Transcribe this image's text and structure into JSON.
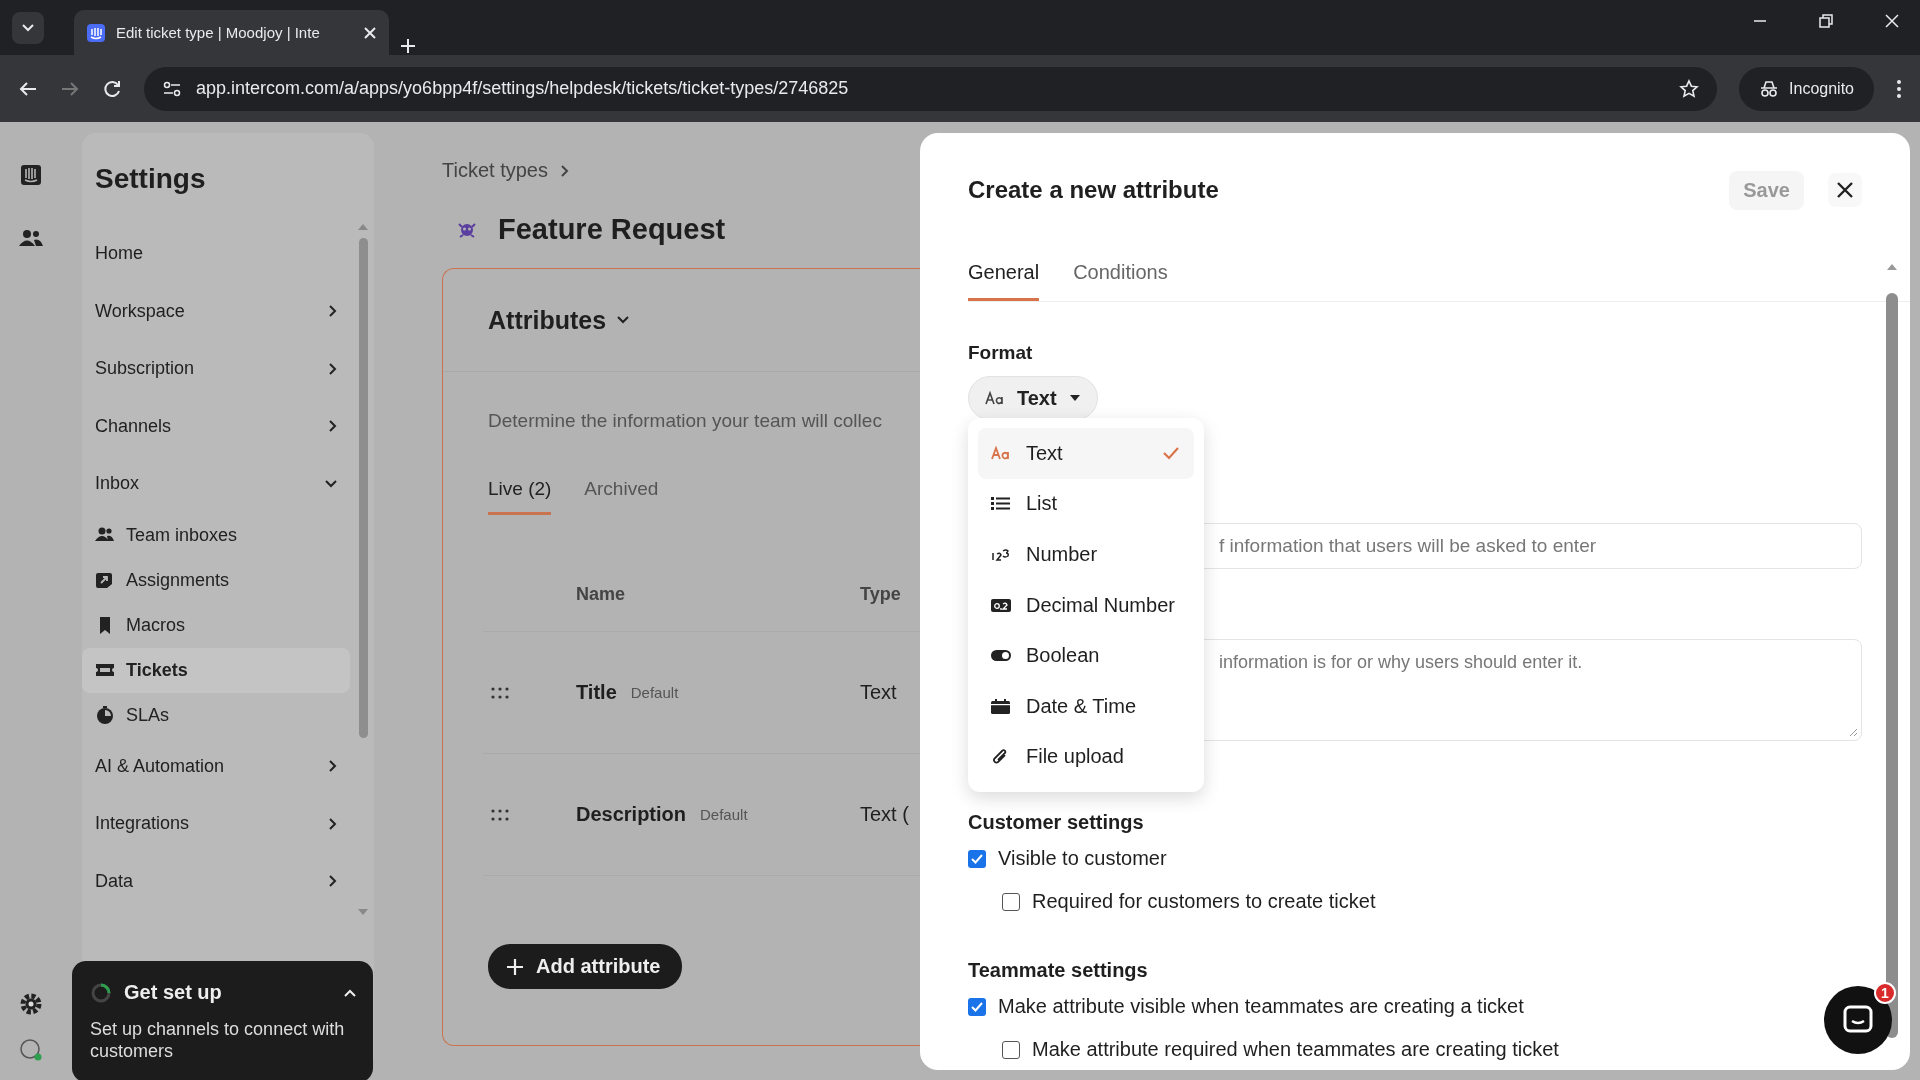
{
  "browser": {
    "tab_title": "Edit ticket type | Moodjoy | Inte",
    "url": "app.intercom.com/a/apps/yo6bpp4f/settings/helpdesk/tickets/ticket-types/2746825",
    "profile": "Incognito"
  },
  "sidebar": {
    "title": "Settings",
    "items": [
      {
        "kind": "link",
        "label": "Home"
      },
      {
        "kind": "group",
        "label": "Workspace",
        "expanded": false
      },
      {
        "kind": "group",
        "label": "Subscription",
        "expanded": false
      },
      {
        "kind": "group",
        "label": "Channels",
        "expanded": false
      },
      {
        "kind": "group",
        "label": "Inbox",
        "expanded": true,
        "children": [
          {
            "kind": "team",
            "label": "Team inboxes",
            "selected": false
          },
          {
            "kind": "assign",
            "label": "Assignments",
            "selected": false
          },
          {
            "kind": "macro",
            "label": "Macros",
            "selected": false
          },
          {
            "kind": "ticket",
            "label": "Tickets",
            "selected": true
          },
          {
            "kind": "sla",
            "label": "SLAs",
            "selected": false
          }
        ]
      },
      {
        "kind": "group",
        "label": "AI & Automation",
        "expanded": false
      },
      {
        "kind": "group",
        "label": "Integrations",
        "expanded": false
      },
      {
        "kind": "group",
        "label": "Data",
        "expanded": false
      }
    ],
    "setup_card": {
      "title": "Get set up",
      "text": "Set up channels to connect with customers"
    }
  },
  "main": {
    "breadcrumb": "Ticket types",
    "title": "Feature Request",
    "section": "Attributes",
    "description": "Determine the information your team will collec",
    "tabs": [
      {
        "label": "Live (2)",
        "selected": true
      },
      {
        "label": "Archived",
        "selected": false
      }
    ],
    "columns": [
      "Name",
      "Type"
    ],
    "rows": [
      {
        "name": "Title",
        "badge": "Default",
        "type": "Text"
      },
      {
        "name": "Description",
        "badge": "Default",
        "type": "Text ("
      }
    ],
    "add_button": "Add attribute"
  },
  "panel": {
    "title": "Create a new attribute",
    "save": "Save",
    "tabs": [
      {
        "label": "General",
        "selected": true
      },
      {
        "label": "Conditions",
        "selected": false
      }
    ],
    "format_label": "Format",
    "format_value": "Text",
    "format_options": [
      {
        "kind": "text",
        "label": "Text",
        "selected": true
      },
      {
        "kind": "list",
        "label": "List",
        "selected": false
      },
      {
        "kind": "number",
        "label": "Number",
        "selected": false
      },
      {
        "kind": "decimal",
        "label": "Decimal Number",
        "selected": false
      },
      {
        "kind": "boolean",
        "label": "Boolean",
        "selected": false
      },
      {
        "kind": "datetime",
        "label": "Date & Time",
        "selected": false
      },
      {
        "kind": "file",
        "label": "File upload",
        "selected": false
      }
    ],
    "name_placeholder": "f information that users will be asked to enter",
    "description_placeholder": "information is for or why users should enter it.",
    "sections": [
      {
        "title": "Customer settings",
        "options": [
          {
            "label": "Visible to customer",
            "checked": true,
            "children": [
              {
                "label": "Required for customers to create ticket",
                "checked": false
              }
            ]
          }
        ]
      },
      {
        "title": "Teammate settings",
        "options": [
          {
            "label": "Make attribute visible when teammates are creating a ticket",
            "checked": true,
            "children": [
              {
                "label": "Make attribute required when teammates are creating ticket",
                "checked": false
              }
            ]
          }
        ]
      }
    ]
  },
  "messenger": {
    "badge": "1"
  }
}
